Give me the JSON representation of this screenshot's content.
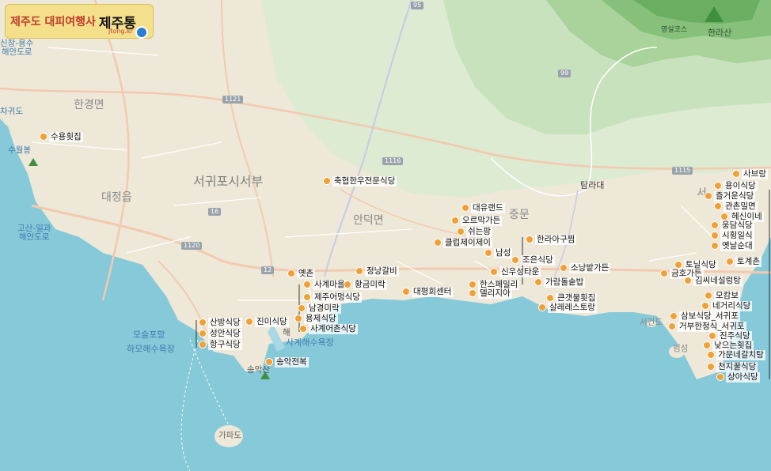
{
  "logo": {
    "text_main": "제주도 대피여행사",
    "text_brand": "제주통",
    "sub": "jtong.kr"
  },
  "regions": {
    "seogwipo_west": "서귀포시서부",
    "hangyeong": "한경면",
    "daejeong": "대정읍",
    "andeok": "안덕면",
    "jungmun": "중문",
    "seo": "서"
  },
  "water_labels": {
    "sincheon": "신창-용수\n해안도로",
    "chagwido": "차귀도",
    "suwolbong": "수월봉",
    "gosan": "고산-일과\n해안도로",
    "moseulpo": "모슬포항",
    "hamo": "하모해수욕장",
    "sagye_beach": "사계해수욕장",
    "gapado": "가파도",
    "seogeondo": "서건도",
    "beomseom": "범섬",
    "songaksan": "송악산",
    "mt_hallasan": "한라산",
    "yeongsil": "영실코스",
    "taramdae": "탐라대"
  },
  "roads": [
    "95",
    "99",
    "1121",
    "1116",
    "1115",
    "16",
    "1120",
    "12"
  ],
  "pois": [
    {
      "id": "suyong",
      "label": "수용횟집"
    },
    {
      "id": "chukhyeop",
      "label": "축협한우전문식당"
    },
    {
      "id": "sabeuraeng",
      "label": "사브랑"
    },
    {
      "id": "yongi",
      "label": "용이식당"
    },
    {
      "id": "jeulgeoun",
      "label": "즐거운식당"
    },
    {
      "id": "gwanchun",
      "label": "관촌밀면"
    },
    {
      "id": "hesini",
      "label": "헤신이네"
    },
    {
      "id": "ungdam",
      "label": "웅담식당"
    },
    {
      "id": "sihwangil",
      "label": "시횡일식"
    },
    {
      "id": "yetnal",
      "label": "옛날순대"
    },
    {
      "id": "togye",
      "label": "토계촌"
    },
    {
      "id": "toryeong",
      "label": "토닐식당"
    },
    {
      "id": "geumho",
      "label": "금호가든"
    },
    {
      "id": "gimsine",
      "label": "김씨네설렁탕"
    },
    {
      "id": "mokambo",
      "label": "모캄보"
    },
    {
      "id": "negeori",
      "label": "네거리식당"
    },
    {
      "id": "sambo",
      "label": "삼보식당_서귀포"
    },
    {
      "id": "geobuhan",
      "label": "거부한정식_서귀포"
    },
    {
      "id": "jinju",
      "label": "진주식당"
    },
    {
      "id": "nateun",
      "label": "낮으는횟집"
    },
    {
      "id": "garyun",
      "label": "가문네갈치탕"
    },
    {
      "id": "cheonji",
      "label": "천지꿀식당"
    },
    {
      "id": "sanga",
      "label": "상아식당"
    },
    {
      "id": "daeyu",
      "label": "대유랜드"
    },
    {
      "id": "oreumak",
      "label": "오르막가든"
    },
    {
      "id": "swineun",
      "label": "쉬는팡"
    },
    {
      "id": "clubjey",
      "label": "클럽제이제이"
    },
    {
      "id": "namseong",
      "label": "남성"
    },
    {
      "id": "hallagu",
      "label": "한라아구찜"
    },
    {
      "id": "joeun",
      "label": "조은식당"
    },
    {
      "id": "sinwoo",
      "label": "신우성타운"
    },
    {
      "id": "sonabal",
      "label": "소낭밭가든"
    },
    {
      "id": "garam",
      "label": "가람돌솥밥"
    },
    {
      "id": "hanseupal",
      "label": "한스페밀리"
    },
    {
      "id": "deli",
      "label": "델리지아"
    },
    {
      "id": "daepyeong",
      "label": "대평회센터"
    },
    {
      "id": "keunget",
      "label": "큰갯물횟집"
    },
    {
      "id": "salle",
      "label": "살레레스토랑"
    },
    {
      "id": "yetchon",
      "label": "옛촌"
    },
    {
      "id": "jeongnang",
      "label": "정낭갈비"
    },
    {
      "id": "sagyemaeul",
      "label": "사계마을"
    },
    {
      "id": "hwanggeum",
      "label": "황금미락"
    },
    {
      "id": "jejueo",
      "label": "제주어멍식당"
    },
    {
      "id": "namgyeong",
      "label": "남경미락"
    },
    {
      "id": "jinmi",
      "label": "진미식당"
    },
    {
      "id": "hae",
      "label": "해"
    },
    {
      "id": "yongje",
      "label": "용제식당"
    },
    {
      "id": "sagyeeochon",
      "label": "사계어촌식당"
    },
    {
      "id": "sanbang",
      "label": "산방식당"
    },
    {
      "id": "seongan",
      "label": "성안식당"
    },
    {
      "id": "hanggu",
      "label": "항구식당"
    },
    {
      "id": "songak",
      "label": "송악전복"
    }
  ]
}
